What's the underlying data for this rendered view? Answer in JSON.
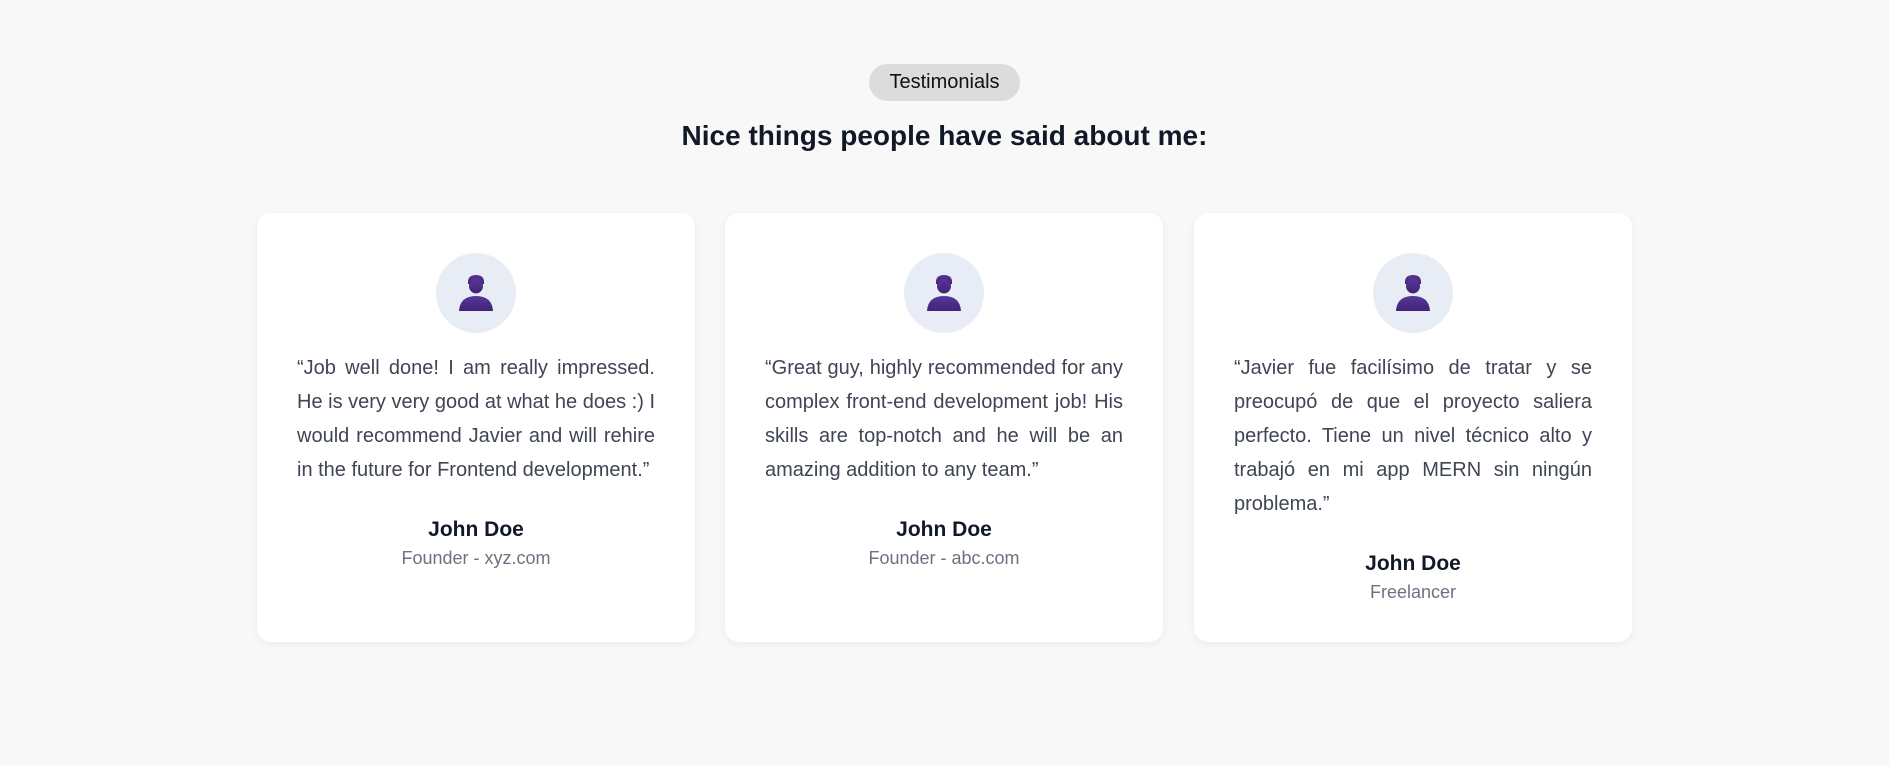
{
  "section": {
    "badge": "Testimonials",
    "title": "Nice things people have said about me:"
  },
  "testimonials": [
    {
      "quote": "“Job well done! I am really impressed. He is very very good at what he does :) I would recommend Javier and will rehire in the future for Frontend development.”",
      "name": "John Doe",
      "role": "Founder - xyz.com",
      "avatar_icon": "user-avatar-icon"
    },
    {
      "quote": "“Great guy, highly recommended for any complex front-end development job! His skills are top-notch and he will be an amazing addition to any team.”",
      "name": "John Doe",
      "role": "Founder - abc.com",
      "avatar_icon": "user-avatar-icon"
    },
    {
      "quote": "“Javier fue facilísimo de tratar y se preocupó de que el proyecto saliera perfecto. Tiene un nivel técnico alto y trabajó en mi app MERN sin ningún problema.”",
      "name": "John Doe",
      "role": "Freelancer",
      "avatar_icon": "user-avatar-icon"
    }
  ],
  "colors": {
    "background": "#f8f8f8",
    "card": "#ffffff",
    "badge": "#dcdcdc",
    "avatar_bg": "#e8ecf4",
    "avatar_figure": "#4c2a85"
  }
}
